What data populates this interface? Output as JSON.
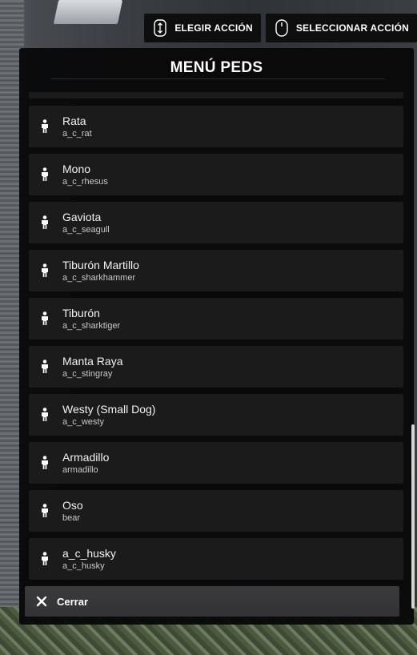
{
  "top_actions": [
    {
      "label": "ELEGIR ACCIÓN",
      "icon": "up-down-arrow-icon"
    },
    {
      "label": "SELECCIONAR ACCIÓN",
      "icon": "mouse-icon"
    }
  ],
  "menu": {
    "title": "MENÚ PEDS",
    "items": [
      {
        "name": "Rata",
        "code": "a_c_rat",
        "icon": "person-icon"
      },
      {
        "name": "Mono",
        "code": "a_c_rhesus",
        "icon": "person-icon"
      },
      {
        "name": "Gaviota",
        "code": "a_c_seagull",
        "icon": "person-icon"
      },
      {
        "name": "Tiburón Martillo",
        "code": "a_c_sharkhammer",
        "icon": "person-icon"
      },
      {
        "name": "Tiburón",
        "code": "a_c_sharktiger",
        "icon": "person-icon"
      },
      {
        "name": "Manta Raya",
        "code": "a_c_stingray",
        "icon": "person-icon"
      },
      {
        "name": "Westy (Small Dog)",
        "code": "a_c_westy",
        "icon": "person-icon"
      },
      {
        "name": "Armadillo",
        "code": "armadillo",
        "icon": "person-icon"
      },
      {
        "name": "Oso",
        "code": "bear",
        "icon": "person-icon"
      },
      {
        "name": "a_c_husky",
        "code": "a_c_husky",
        "icon": "person-icon"
      }
    ],
    "close_label": "Cerrar"
  },
  "colors": {
    "panel": "#08080a",
    "item": "#1b1b1c",
    "text": "#ffffff"
  }
}
